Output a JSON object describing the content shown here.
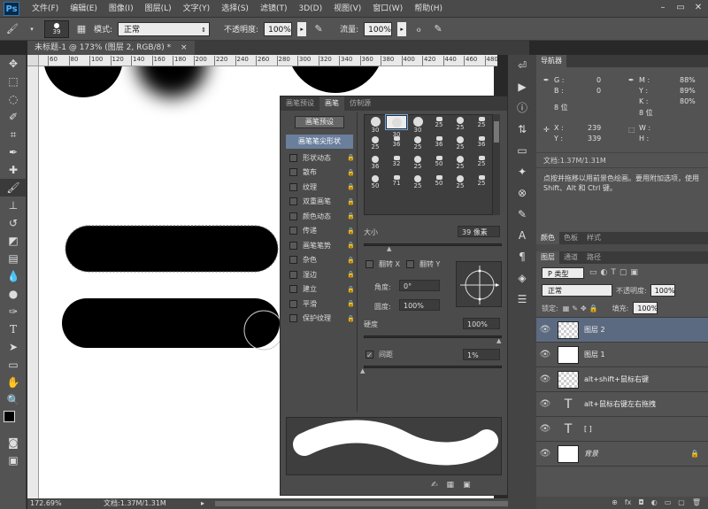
{
  "menubar": {
    "logo": "Ps",
    "items": [
      "文件(F)",
      "编辑(E)",
      "图像(I)",
      "图层(L)",
      "文字(Y)",
      "选择(S)",
      "滤镜(T)",
      "3D(D)",
      "视图(V)",
      "窗口(W)",
      "帮助(H)"
    ],
    "win_min": "–",
    "win_max": "▭",
    "win_close": "✕"
  },
  "options": {
    "brush_size": "39",
    "mode_label": "模式:",
    "mode_value": "正常",
    "opacity_label": "不透明度:",
    "opacity_value": "100%",
    "flow_label": "流量:",
    "flow_value": "100%"
  },
  "document": {
    "tab_title": "未标题-1 @ 173% (图层 2, RGB/8) *",
    "tab_close": "×",
    "ruler_ticks": [
      "60",
      "80",
      "100",
      "120",
      "140",
      "160",
      "180",
      "200",
      "220",
      "240",
      "260",
      "280",
      "300",
      "320",
      "340",
      "360",
      "380",
      "400",
      "420",
      "440",
      "460",
      "480"
    ]
  },
  "status": {
    "zoom": "172.69%",
    "doc": "文档:1.37M/1.31M"
  },
  "brush_panel": {
    "tabs": [
      "画笔预设",
      "画笔",
      "仿制源"
    ],
    "preset_button": "画笔预设",
    "tip_shape": "画笔笔尖形状",
    "options": [
      "形状动态",
      "散布",
      "纹理",
      "双重画笔",
      "颜色动态",
      "传递",
      "画笔笔势",
      "杂色",
      "湿边",
      "建立",
      "平滑",
      "保护纹理"
    ],
    "tip_sizes": [
      "30",
      "30",
      "30",
      "25",
      "25",
      "25",
      "25",
      "36",
      "25",
      "36",
      "25",
      "36",
      "36",
      "32",
      "25",
      "50",
      "25",
      "25",
      "50",
      "71",
      "25",
      "50",
      "25",
      "25"
    ],
    "size_label": "大小",
    "size_value": "39 像素",
    "flip_x": "翻转 X",
    "flip_y": "翻转 Y",
    "angle_label": "角度:",
    "angle_value": "0°",
    "roundness_label": "圆度:",
    "roundness_value": "100%",
    "hardness_label": "硬度",
    "hardness_value": "100%",
    "spacing_label": "间距",
    "spacing_value": "1%",
    "check_mark": "✓",
    "lock_glyph": "🔒"
  },
  "info_panel": {
    "tab": "导航器",
    "g_label": "G :",
    "g_value": "0",
    "b_label": "B :",
    "b_value": "0",
    "bit_left": "8 位",
    "m_label": "M :",
    "m_value": "88%",
    "y_label": "Y :",
    "y_value": "89%",
    "k_label": "K :",
    "k_value": "80%",
    "bit_right": "8 位",
    "x_label": "X :",
    "x_value": "239",
    "ypos_label": "Y :",
    "ypos_value": "339",
    "w_label": "W :",
    "h_label": "H :",
    "doc": "文档:1.37M/1.31M",
    "hint": "点按并拖移以用前景色绘画。要用附加选项，使用 Shift、Alt 和 Ctrl 键。"
  },
  "swatch_tabs": [
    "颜色",
    "色板",
    "样式"
  ],
  "layers_panel": {
    "tabs": [
      "图层",
      "通道",
      "路径"
    ],
    "filter_value": "P 类型",
    "blend_value": "正常",
    "opacity_label": "不透明度:",
    "opacity_value": "100%",
    "lock_label": "锁定:",
    "fill_label": "填充:",
    "fill_value": "100%",
    "layers": [
      {
        "name": "图层 2"
      },
      {
        "name": "图层 1"
      },
      {
        "name": "alt+shift+鼠标右键"
      },
      {
        "name": "alt+鼠标右键左右拖拽"
      },
      {
        "name": "[ ]"
      },
      {
        "name": "背景"
      }
    ],
    "footer_icons": [
      "⊕",
      "fx",
      "◘",
      "◐",
      "▭",
      "▢",
      "🗑"
    ]
  },
  "colors": {
    "accent": "#5b6a80",
    "canvas_bg": "#ffffff",
    "panel_bg": "#535353"
  }
}
